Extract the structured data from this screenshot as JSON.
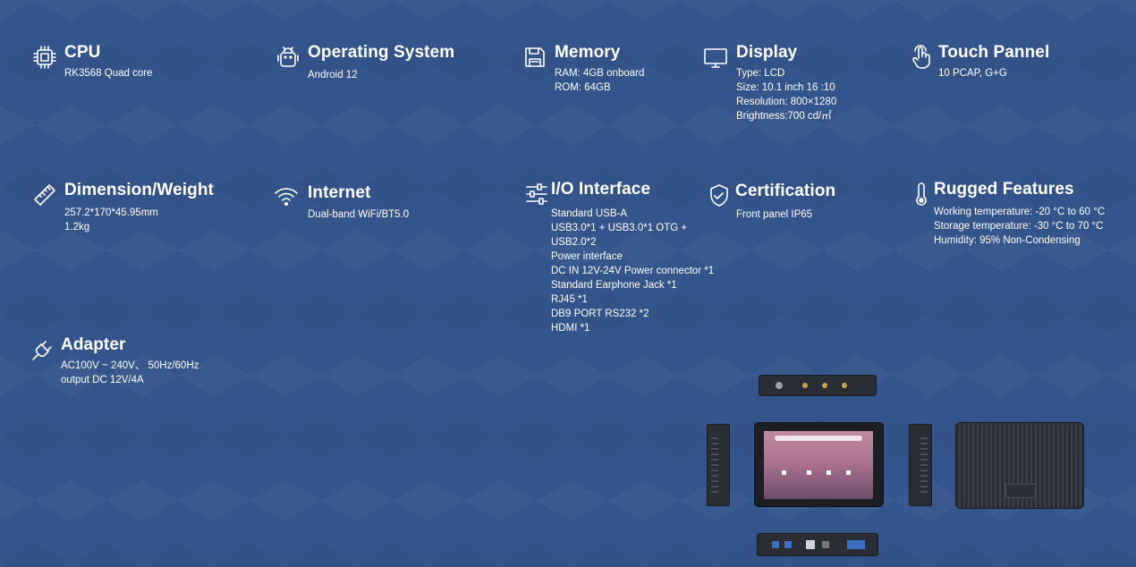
{
  "specs": {
    "cpu": {
      "icon": "cpu-icon",
      "title": "CPU",
      "lines": [
        "RK3568 Quad core"
      ]
    },
    "os": {
      "icon": "android-icon",
      "title": "Operating System",
      "lines": [
        "Android 12"
      ]
    },
    "memory": {
      "icon": "save-icon",
      "title": "Memory",
      "lines": [
        "RAM: 4GB  onboard",
        "ROM: 64GB"
      ]
    },
    "display": {
      "icon": "monitor-icon",
      "title": "Display",
      "lines": [
        "Type: LCD",
        "Size: 10.1 inch    16 :10",
        "Resolution:  800×1280",
        "Brightness:700 cd/㎡"
      ]
    },
    "touch": {
      "icon": "touch-hand-icon",
      "title": "Touch Pannel",
      "lines": [
        "10 PCAP, G+G"
      ]
    },
    "dimension": {
      "icon": "ruler-icon",
      "title": "Dimension/Weight",
      "lines": [
        "257.2*170*45.95mm",
        "1.2kg"
      ]
    },
    "internet": {
      "icon": "wifi-icon",
      "title": "Internet",
      "lines": [
        "Dual-band WiFi/BT5.0"
      ]
    },
    "io": {
      "icon": "sliders-icon",
      "title": "I/O Interface",
      "lines": [
        "Standard USB-A",
        "USB3.0*1  + USB3.0*1 OTG +",
        "USB2.0*2",
        "Power interface",
        "DC IN 12V-24V  Power connector  *1",
        "Standard Earphone Jack  *1",
        "RJ45 *1",
        "DB9 PORT  RS232  *2",
        "HDMI  *1"
      ]
    },
    "certification": {
      "icon": "shield-check-icon",
      "title": "Certification",
      "lines": [
        "Front panel IP65"
      ]
    },
    "rugged": {
      "icon": "thermometer-icon",
      "title": "Rugged Features",
      "lines": [
        "Working temperature: -20 °C to 60 °C",
        "Storage temperature: -30 °C to 70 °C",
        "Humidity: 95% Non-Condensing"
      ]
    },
    "adapter": {
      "icon": "plug-icon",
      "title": "Adapter",
      "lines": [
        "AC100V ~ 240V、 50Hz/60Hz",
        "output DC 12V/4A"
      ]
    }
  },
  "colors": {
    "background": "#34558c",
    "text": "#ffffff",
    "device": "#2a2d33"
  }
}
